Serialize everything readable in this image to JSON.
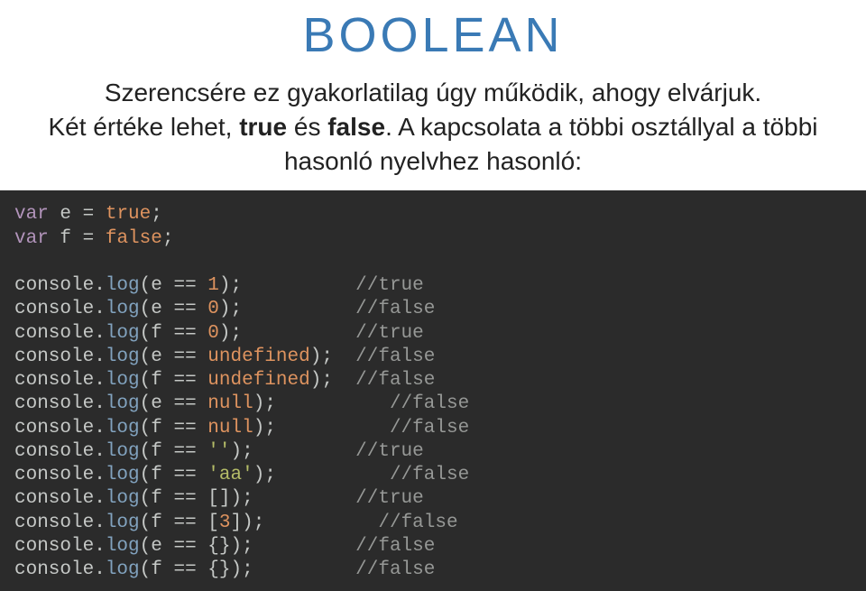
{
  "heading": "BOOLEAN",
  "paragraph": {
    "line1": "Szerencsére ez gyakorlatilag úgy működik, ahogy elvárjuk.",
    "line2_pre": "Két értéke lehet, ",
    "line2_b1": "true",
    "line2_mid": " és ",
    "line2_b2": "false",
    "line2_post": ". A kapcsolata a többi osztállyal a többi hasonló nyelvhez hasonló:"
  },
  "code": {
    "var": "var",
    "e": "e",
    "f": "f",
    "eq": " = ",
    "eqeq": " == ",
    "true": "true",
    "false": "false",
    "semi": ";",
    "console": "console",
    "dot": ".",
    "log": "log",
    "lp": "(",
    "rp": ")",
    "one": "1",
    "zero": "0",
    "undefined": "undefined",
    "null": "null",
    "emptyStr": "''",
    "aaStr": "'aa'",
    "emptyArr_l": "[",
    "emptyArr_r": "]",
    "three": "3",
    "emptyObj": "{}",
    "comments": {
      "true": "//true",
      "false": "//false"
    },
    "pad": {
      "p1": "          ",
      "p0e": "          ",
      "p0f": "          ",
      "pundef_e": "  ",
      "pundef_f": "  ",
      "pnull_e": "          ",
      "pnull_f": "          ",
      "pempty": "         ",
      "paa": "          ",
      "parr": "         ",
      "parr3": "          ",
      "pobj_e": "         ",
      "pobj_f": "         "
    }
  }
}
